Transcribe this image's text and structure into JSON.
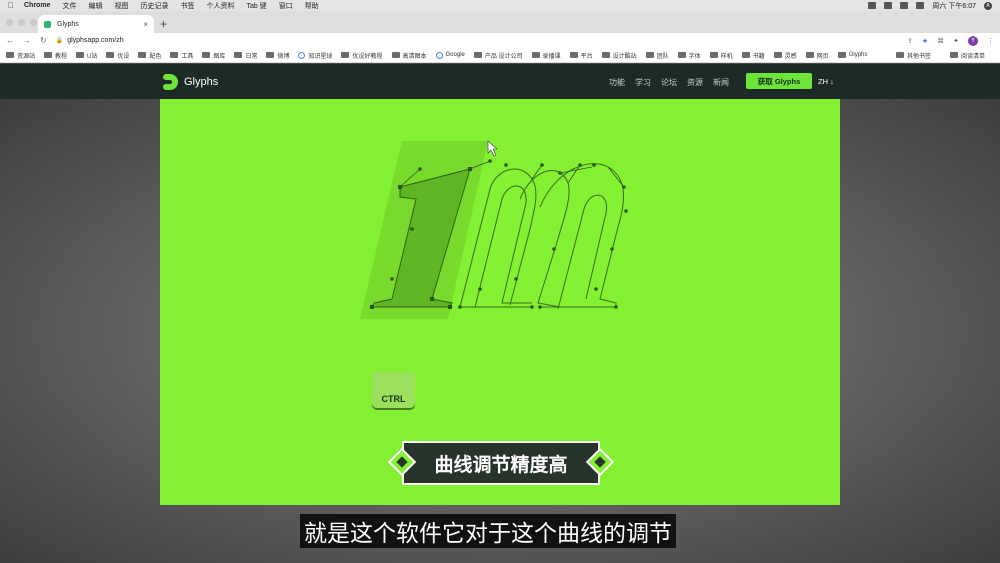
{
  "menubar": {
    "app": "Chrome",
    "items": [
      "文件",
      "编辑",
      "视图",
      "历史记录",
      "书签",
      "个人资料",
      "Tab 键",
      "窗口",
      "帮助"
    ],
    "clock": "周六 下午6:07"
  },
  "browser": {
    "tab_title": "Glyphs",
    "url": "glyphsapp.com/zh",
    "bookmarks": [
      "资源站",
      "教程",
      "U站",
      "优设",
      "配色",
      "工具",
      "图库",
      "日常",
      "微博",
      "知识星球",
      "优设好教程",
      "高清图本",
      "Google",
      "产品 设计公司",
      "录播课",
      "平台",
      "设计酷站",
      "团队",
      "字体",
      "样机",
      "书籍",
      "灵感",
      "网页",
      "Glyphs"
    ],
    "bookmarks_right": [
      "其他书签",
      "阅读清单"
    ]
  },
  "site": {
    "logo_text": "Glyphs",
    "nav": [
      "功能",
      "学习",
      "论坛",
      "资源",
      "新闻"
    ],
    "cta": "获取 Glyphs",
    "lang": "ZH ↓"
  },
  "hero": {
    "key_label": "CTRL",
    "banner_text": "曲线调节精度高"
  },
  "subtitle": "就是这个软件它对于这个曲线的调节",
  "colors": {
    "brand_green": "#83f032",
    "nav_bg": "#1e2a26",
    "cta_green": "#6ee33a"
  }
}
